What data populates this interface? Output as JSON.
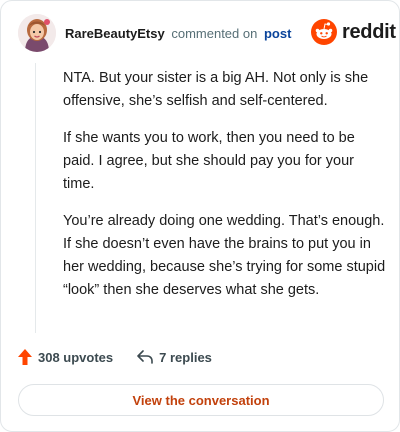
{
  "comment": {
    "author": "RareBeautyEtsy",
    "action_text": "commented on",
    "target_link": "post",
    "paragraphs": [
      "NTA. But your sister is a big AH. Not only is she offensive, she’s selfish and self-centered.",
      "If she wants you to work, then you need to be paid. I agree, but she should pay you for your time.",
      "You’re already doing one wedding. That’s enough. If she doesn’t even have the brains to put you in her wedding, because she’s trying for some stupid “look” then she deserves what she gets."
    ]
  },
  "brand": {
    "wordmark": "reddit",
    "icon": "reddit-snoo-icon",
    "color": "#ff4500"
  },
  "stats": {
    "upvotes": "308 upvotes",
    "upvote_icon": "upvote-arrow-icon",
    "upvote_color": "#ff4500",
    "replies": "7 replies",
    "reply_icon": "reply-arrow-icon"
  },
  "cta": {
    "label": "View the conversation",
    "color": "#c2410c"
  }
}
